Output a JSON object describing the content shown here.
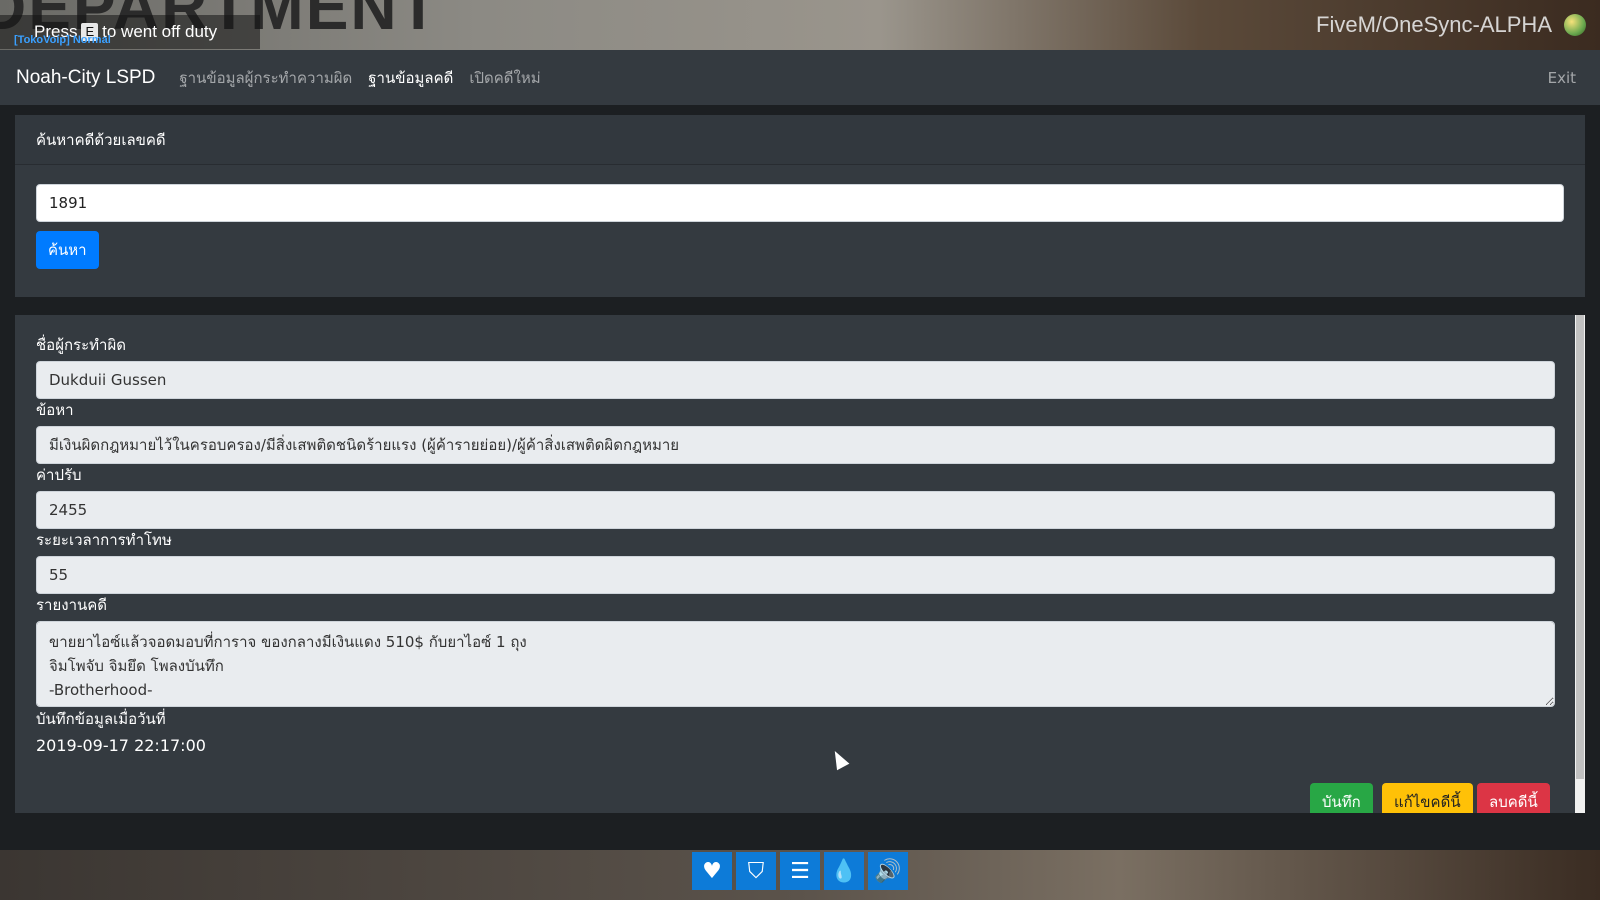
{
  "overlay": {
    "duty_prefix": "Press",
    "duty_key": "E",
    "duty_suffix": "to went off duty",
    "voip_status": "[TokoVoip] Normal",
    "server_name": "FiveM/OneSync-ALPHA",
    "game_background_text": "DEPARTMENT"
  },
  "navbar": {
    "brand": "Noah-City LSPD",
    "links": [
      {
        "label": "ฐานข้อมูลผู้กระทำความผิด",
        "active": false
      },
      {
        "label": "ฐานข้อมูลคดี",
        "active": true
      },
      {
        "label": "เปิดคดีใหม่",
        "active": false
      }
    ],
    "exit_label": "Exit"
  },
  "search_card": {
    "header": "ค้นหาคดีด้วยเลขคดี",
    "input_value": "1891",
    "search_button": "ค้นหา"
  },
  "case": {
    "offender_label": "ชื่อผู้กระทำผิด",
    "offender_value": "Dukduii Gussen",
    "charge_label": "ข้อหา",
    "charge_value": "มีเงินผิดกฎหมายไว้ในครอบครอง/มีสิ่งเสพติดชนิดร้ายแรง (ผู้ค้ารายย่อย)/ผู้ค้าสิ่งเสพติดผิดกฎหมาย",
    "fine_label": "ค่าปรับ",
    "fine_value": "2455",
    "sentence_label": "ระยะเวลาการทำโทษ",
    "sentence_value": "55",
    "report_label": "รายงานคดี",
    "report_value": "ขายยาไอซ์แล้วจอดมอบที่การาจ ของกลางมีเงินแดง 510$ กับยาไอซ์ 1 ถุง\nจิมโพจับ จิมยึด โพลงบันทึก\n-Brotherhood-",
    "date_label": "บันทึกข้อมูลเมื่อวันที่",
    "date_value": "2019-09-17 22:17:00",
    "save_button": "บันทึก",
    "edit_button": "แก้ไขคดีนี้",
    "delete_button": "ลบคดีนี้"
  },
  "hud": [
    {
      "icon": "heart-icon",
      "glyph": "♥"
    },
    {
      "icon": "shield-icon",
      "glyph": "⛉"
    },
    {
      "icon": "burger-icon",
      "glyph": "☰"
    },
    {
      "icon": "water-drop-icon",
      "glyph": "💧"
    },
    {
      "icon": "speaker-icon",
      "glyph": "🔊"
    }
  ]
}
